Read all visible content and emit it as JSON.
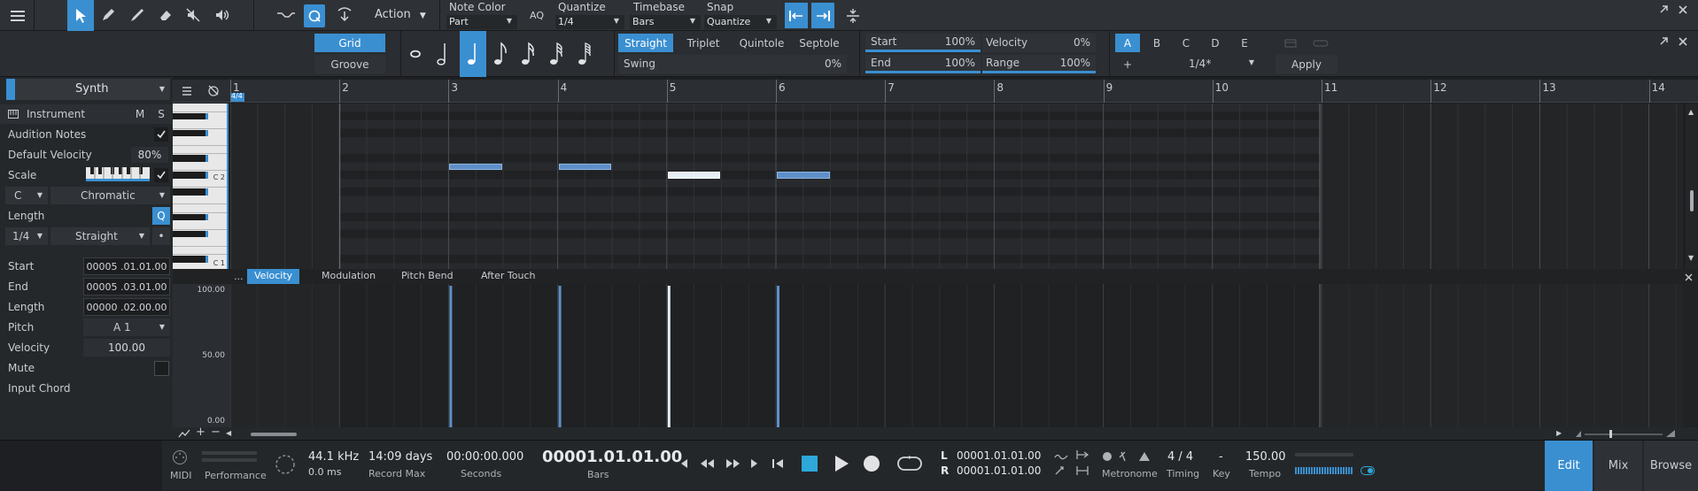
{
  "toolbar": {
    "action_label": "Action",
    "note_color_label": "Note Color",
    "note_color_value": "Part",
    "aq_label": "AQ",
    "quantize_label": "Quantize",
    "quantize_value": "1/4",
    "timebase_label": "Timebase",
    "timebase_value": "Bars",
    "snap_label": "Snap",
    "snap_value": "Quantize"
  },
  "editbar": {
    "grid_label": "Grid",
    "groove_label": "Groove",
    "straight_label": "Straight",
    "triplet_label": "Triplet",
    "quintole_label": "Quintole",
    "septole_label": "Septole",
    "swing_label": "Swing",
    "swing_value": "0%",
    "start_label": "Start",
    "start_value": "100%",
    "end_label": "End",
    "end_value": "100%",
    "velocity_label": "Velocity",
    "velocity_value": "0%",
    "range_label": "Range",
    "range_value": "100%",
    "slots": [
      "A",
      "B",
      "C",
      "D",
      "E"
    ],
    "plus_label": "+",
    "preset_value": "1/4*",
    "apply_label": "Apply"
  },
  "inspector": {
    "track_name": "Synth",
    "instrument_label": "Instrument",
    "mute_btn": "M",
    "solo_btn": "S",
    "audition_label": "Audition Notes",
    "default_velocity_label": "Default Velocity",
    "default_velocity_value": "80%",
    "scale_label": "Scale",
    "scale_root": "C",
    "scale_type": "Chromatic",
    "length_label": "Length",
    "q_label": "Q",
    "length_value": "1/4",
    "length_mode": "Straight",
    "start_label": "Start",
    "start_value": "00005 .01.01.00",
    "end_label": "End",
    "end_value": "00005 .03.01.00",
    "note_length_label": "Length",
    "note_length_value": "00000 .02.00.00",
    "pitch_label": "Pitch",
    "pitch_value": "A 1",
    "velocity_label": "Velocity",
    "velocity_value": "100.00",
    "mute_label": "Mute",
    "input_chord_label": "Input Chord"
  },
  "ruler": {
    "time_sig": "4/4",
    "bars": [
      "1",
      "2",
      "3",
      "4",
      "5",
      "6",
      "7",
      "8",
      "9",
      "10",
      "11",
      "12",
      "13",
      "14"
    ]
  },
  "keys": {
    "c2": "C 2",
    "c1": "C 1"
  },
  "lanes": {
    "tabs": [
      "Velocity",
      "Modulation",
      "Pitch Bend",
      "After Touch"
    ],
    "more": "...",
    "y_top": "100.00",
    "y_mid": "50.00",
    "y_bot": "0.00"
  },
  "notes": [
    {
      "bar": 3,
      "beat": 1,
      "length_beats": 2,
      "row": 7,
      "selected": false,
      "velocity": 1.0
    },
    {
      "bar": 4,
      "beat": 1,
      "length_beats": 2,
      "row": 7,
      "selected": false,
      "velocity": 1.0
    },
    {
      "bar": 5,
      "beat": 1,
      "length_beats": 2,
      "row": 8,
      "selected": true,
      "velocity": 1.0
    },
    {
      "bar": 6,
      "beat": 1,
      "length_beats": 2,
      "row": 8,
      "selected": false,
      "velocity": 1.0
    }
  ],
  "transport": {
    "midi_label": "MIDI",
    "performance_label": "Performance",
    "sample_rate": "44.1 kHz",
    "latency": "0.0 ms",
    "record_max_value": "14:09 days",
    "record_max_label": "Record Max",
    "seconds_value": "00:00:00.000",
    "seconds_label": "Seconds",
    "bars_value": "00001.01.01.00",
    "bars_label": "Bars",
    "l_label": "L",
    "r_label": "R",
    "l_value": "00001.01.01.00",
    "r_value": "00001.01.01.00",
    "metronome_label": "Metronome",
    "timing_value": "4 / 4",
    "timing_label": "Timing",
    "key_value": "-",
    "key_label": "Key",
    "tempo_value": "150.00",
    "tempo_label": "Tempo",
    "edit_label": "Edit",
    "mix_label": "Mix",
    "browse_label": "Browse"
  },
  "colors": {
    "accent": "#3a8fd1",
    "note": "#5f8fc8",
    "note_selected": "#e6eef6",
    "background": "#1d1f22"
  }
}
